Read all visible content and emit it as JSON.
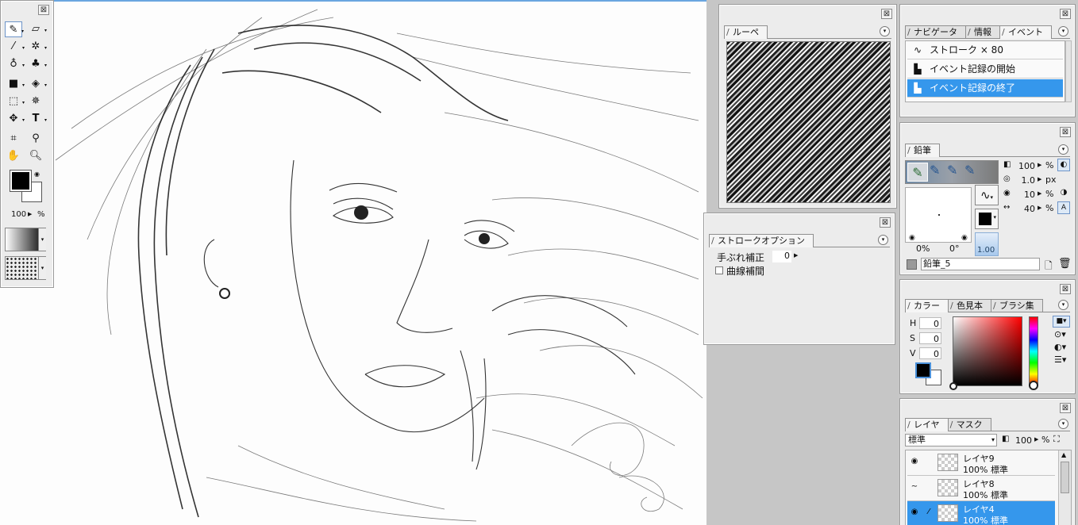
{
  "toolbox": {
    "close": "⊠",
    "opacity_value": "100",
    "opacity_unit": "%",
    "foreground_color": "#000000",
    "background_color": "#ffffff"
  },
  "loupe": {
    "tab": "ルーペ",
    "close": "⊠"
  },
  "stroke_options": {
    "tab": "ストロークオプション",
    "close": "⊠",
    "smoothing_label": "手ぶれ補正",
    "smoothing_value": "0",
    "curve_label": "曲線補間"
  },
  "navigator": {
    "close": "⊠",
    "tabs": [
      "ナビゲータ",
      "情報",
      "イベント"
    ],
    "events": [
      {
        "icon": "stroke-icon",
        "label": "ストローク × 80"
      },
      {
        "icon": "event-record-icon",
        "label": "イベント記録の開始"
      },
      {
        "icon": "event-record-icon",
        "label": "イベント記録の終了"
      }
    ]
  },
  "pencil": {
    "tab": "鉛筆",
    "close": "⊠",
    "opacity_value": "100",
    "opacity_unit": "%",
    "size_value": "1.0",
    "size_unit": "px",
    "min_value": "10",
    "min_unit": "%",
    "spacing_value": "40",
    "spacing_unit": "%",
    "angle_left": "0%",
    "angle_right": "0°",
    "scale_value": "1.00",
    "preset_name": "鉛筆_5"
  },
  "color": {
    "close": "⊠",
    "tabs": [
      "カラー",
      "色見本",
      "ブラシ集"
    ],
    "h_label": "H",
    "h_value": "0",
    "s_label": "S",
    "s_value": "0",
    "v_label": "V",
    "v_value": "0",
    "hue_color": "#ff0000"
  },
  "layers": {
    "close": "⊠",
    "tabs": [
      "レイヤ",
      "マスク"
    ],
    "blend_mode": "標準",
    "opacity_value": "100",
    "opacity_unit": "%",
    "items": [
      {
        "name": "レイヤ9",
        "mode": "100% 標準"
      },
      {
        "name": "レイヤ8",
        "mode": "100% 標準"
      },
      {
        "name": "レイヤ4",
        "mode": "100% 標準"
      }
    ]
  }
}
